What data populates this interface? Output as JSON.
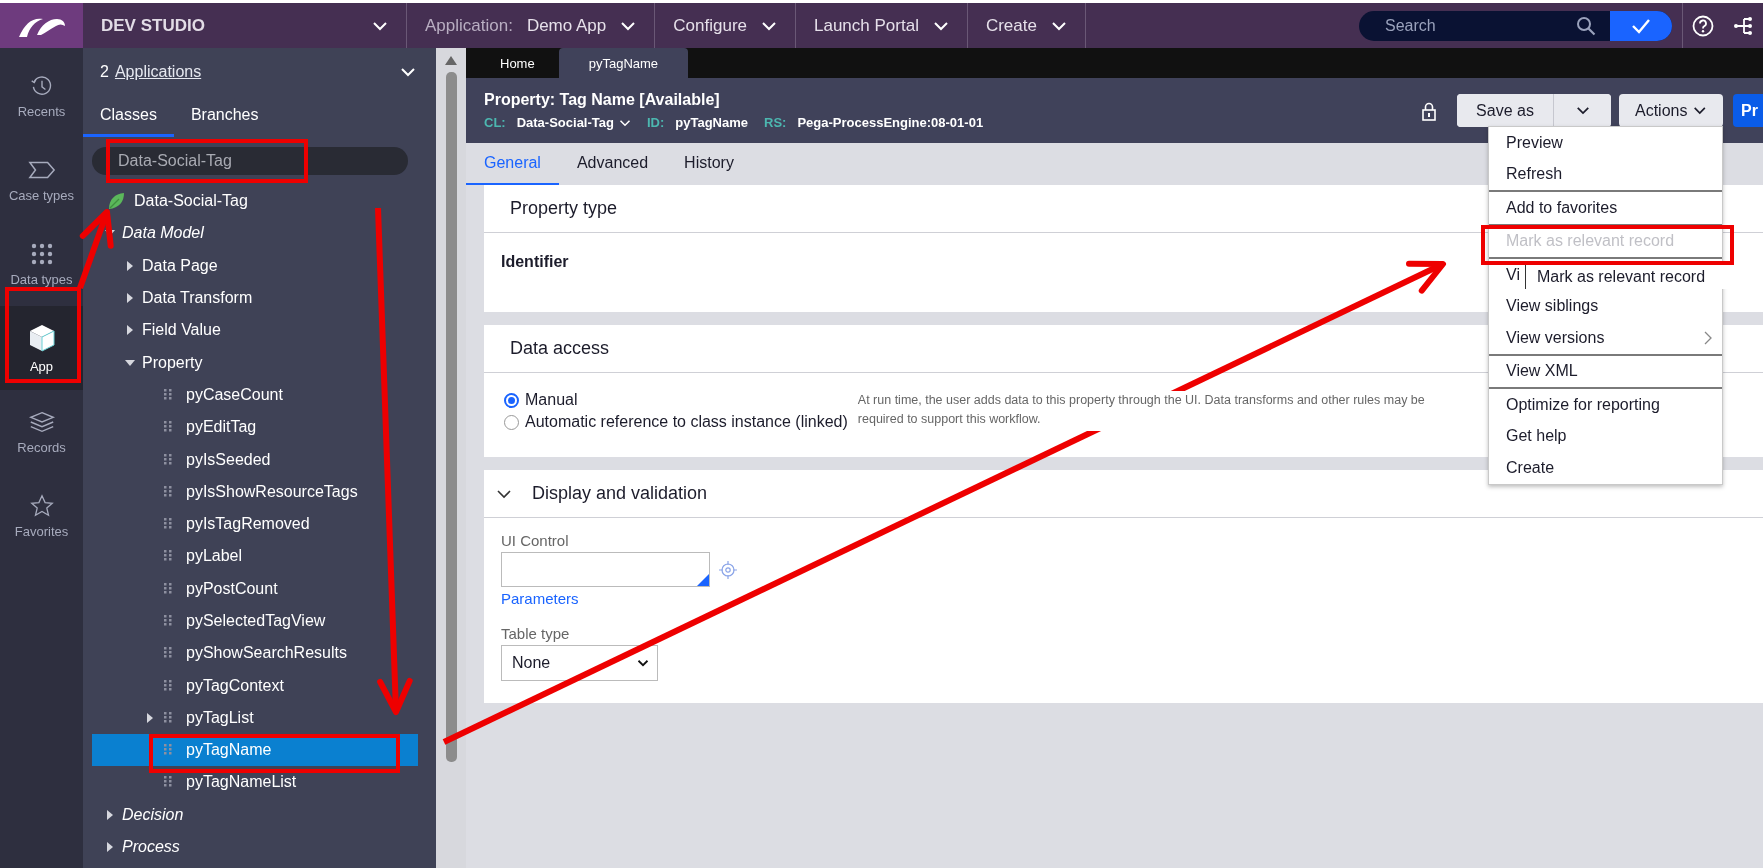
{
  "top_bar": {
    "product": "DEV STUDIO",
    "application_label": "Application:",
    "application": "Demo App",
    "menus": [
      "Configure",
      "Launch Portal",
      "Create"
    ],
    "search": {
      "placeholder": "Search"
    }
  },
  "rail": [
    {
      "label": "Recents",
      "kind": "recents",
      "selected": false
    },
    {
      "label": "Case types",
      "kind": "case-types",
      "selected": false
    },
    {
      "label": "Data types",
      "kind": "data-types",
      "selected": false
    },
    {
      "label": "App",
      "kind": "app",
      "selected": true
    },
    {
      "label": "Records",
      "kind": "records",
      "selected": false
    },
    {
      "label": "Favorites",
      "kind": "favorites",
      "selected": false
    }
  ],
  "explorer": {
    "count": "2",
    "link": "Applications",
    "tabs": [
      {
        "label": "Classes",
        "selected": true
      },
      {
        "label": "Branches",
        "selected": false
      }
    ],
    "class_field": {
      "value": "Data-Social-Tag"
    },
    "tree": [
      {
        "label": "Data-Social-Tag",
        "kind": "class",
        "selected": false,
        "children": [
          {
            "label": "Data Model",
            "kind": "category",
            "expanded": true,
            "selected": false,
            "children": [
              {
                "label": "Data Page",
                "kind": "rule-type",
                "expanded": false,
                "selected": false
              },
              {
                "label": "Data Transform",
                "kind": "rule-type",
                "expanded": false,
                "selected": false
              },
              {
                "label": "Field Value",
                "kind": "rule-type",
                "expanded": false,
                "selected": false
              },
              {
                "label": "Property",
                "kind": "rule-type",
                "expanded": true,
                "selected": false,
                "children": [
                  {
                    "label": "pyCaseCount",
                    "kind": "rule",
                    "selected": false
                  },
                  {
                    "label": "pyEditTag",
                    "kind": "rule",
                    "selected": false
                  },
                  {
                    "label": "pyIsSeeded",
                    "kind": "rule",
                    "selected": false
                  },
                  {
                    "label": "pyIsShowResourceTags",
                    "kind": "rule",
                    "selected": false
                  },
                  {
                    "label": "pyIsTagRemoved",
                    "kind": "rule",
                    "selected": false
                  },
                  {
                    "label": "pyLabel",
                    "kind": "rule",
                    "selected": false
                  },
                  {
                    "label": "pyPostCount",
                    "kind": "rule",
                    "selected": false
                  },
                  {
                    "label": "pySelectedTagView",
                    "kind": "rule",
                    "selected": false
                  },
                  {
                    "label": "pyShowSearchResults",
                    "kind": "rule",
                    "selected": false
                  },
                  {
                    "label": "pyTagContext",
                    "kind": "rule",
                    "selected": false
                  },
                  {
                    "label": "pyTagList",
                    "kind": "rule",
                    "expanded": false,
                    "selected": false
                  },
                  {
                    "label": "pyTagName",
                    "kind": "rule",
                    "selected": true
                  },
                  {
                    "label": "pyTagNameList",
                    "kind": "rule",
                    "selected": false
                  }
                ]
              }
            ]
          },
          {
            "label": "Decision",
            "kind": "category",
            "expanded": false,
            "selected": false
          },
          {
            "label": "Process",
            "kind": "category",
            "expanded": false,
            "selected": false
          }
        ]
      }
    ]
  },
  "doc_tabs": [
    {
      "label": "Home",
      "selected": false
    },
    {
      "label": "pyTagName",
      "selected": true
    }
  ],
  "record": {
    "title": "Property: Tag Name [Available]",
    "meta": [
      {
        "key": "CL:",
        "value": "Data-Social-Tag",
        "dropdown": true
      },
      {
        "key": "ID:",
        "value": "pyTagName",
        "dropdown": false
      },
      {
        "key": "RS:",
        "value": "Pega-ProcessEngine:08-01-01",
        "dropdown": false
      }
    ],
    "save_button": "Save as",
    "actions_button": "Actions",
    "primary_button": "Pr"
  },
  "form_tabs": [
    {
      "label": "General",
      "selected": true
    },
    {
      "label": "Advanced",
      "selected": false
    },
    {
      "label": "History",
      "selected": false
    }
  ],
  "sections": [
    {
      "kind": "info",
      "title": "Property type",
      "value": "Identifier"
    },
    {
      "kind": "options",
      "title": "Data access",
      "options": [
        {
          "label": "Manual",
          "selected": true
        },
        {
          "label": "Automatic reference to class instance (linked)",
          "selected": false
        }
      ],
      "help": "At run time, the user adds data to this property through the UI. Data transforms and other rules may be required to support this workflow."
    },
    {
      "kind": "fields",
      "title": "Display and validation",
      "expanded": true,
      "control_label": "UI Control",
      "link": "Parameters",
      "table_label": "Table type",
      "table_value": "None"
    }
  ],
  "actions_menu": {
    "items": [
      {
        "label": "Preview",
        "disabled": false,
        "divider": false,
        "submenu": false
      },
      {
        "label": "Refresh",
        "disabled": false,
        "divider": true,
        "submenu": false
      },
      {
        "label": "Add to favorites",
        "disabled": false,
        "divider": true,
        "submenu": false
      },
      {
        "label": "Mark as relevant record",
        "disabled": true,
        "divider": true,
        "submenu": false
      },
      {
        "label": "Vi",
        "disabled": false,
        "divider": false,
        "tooltip": "Mark as relevant record"
      },
      {
        "label": "View siblings",
        "disabled": false,
        "divider": false,
        "submenu": false
      },
      {
        "label": "View versions",
        "disabled": false,
        "divider": true,
        "submenu": true
      },
      {
        "label": "View XML",
        "disabled": false,
        "divider": true,
        "submenu": false
      },
      {
        "label": "Optimize for reporting",
        "disabled": false,
        "divider": false,
        "submenu": false
      },
      {
        "label": "Get help",
        "disabled": false,
        "divider": false,
        "submenu": false
      },
      {
        "label": "Create",
        "disabled": false,
        "divider": false,
        "submenu": false
      }
    ]
  }
}
